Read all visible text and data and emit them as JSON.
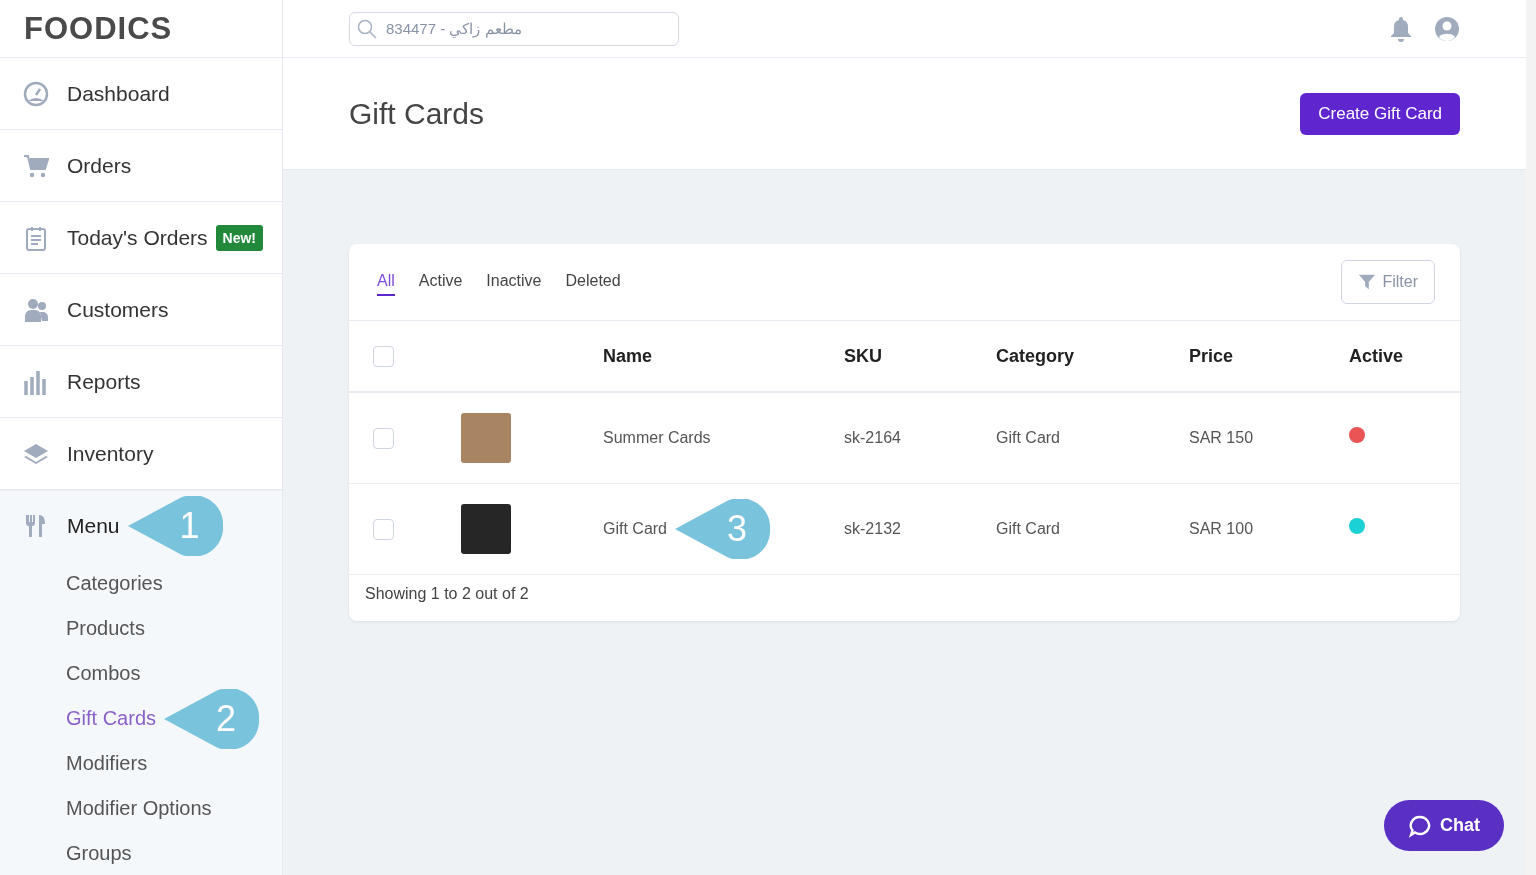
{
  "logo": "FOODICS",
  "search": {
    "value": "834477 - مطعم زاكي"
  },
  "nav": [
    {
      "label": "Dashboard",
      "expanded": false
    },
    {
      "label": "Orders",
      "expanded": false
    },
    {
      "label": "Today's Orders",
      "badge": "New!",
      "expanded": false
    },
    {
      "label": "Customers",
      "expanded": false
    },
    {
      "label": "Reports",
      "expanded": false
    },
    {
      "label": "Inventory",
      "expanded": false
    },
    {
      "label": "Menu",
      "expanded": true,
      "callout": "1",
      "children": [
        {
          "label": "Categories",
          "selected": false
        },
        {
          "label": "Products",
          "selected": false
        },
        {
          "label": "Combos",
          "selected": false
        },
        {
          "label": "Gift Cards",
          "selected": true,
          "callout": "2"
        },
        {
          "label": "Modifiers",
          "selected": false
        },
        {
          "label": "Modifier Options",
          "selected": false
        },
        {
          "label": "Groups",
          "selected": false
        }
      ]
    }
  ],
  "page_title": "Gift Cards",
  "create_button": "Create Gift Card",
  "tabs": [
    {
      "label": "All",
      "selected": true
    },
    {
      "label": "Active",
      "selected": false
    },
    {
      "label": "Inactive",
      "selected": false
    },
    {
      "label": "Deleted",
      "selected": false
    }
  ],
  "filter_button": "Filter",
  "table": {
    "select_all": {
      "checked": false
    },
    "columns": [
      "Name",
      "SKU",
      "Category",
      "Price",
      "Active"
    ],
    "rows": [
      {
        "checked": false,
        "name": "Summer Cards",
        "sku": "sk-2164",
        "category": "Gift Card",
        "price": "SAR 150",
        "color": "#ea5455"
      },
      {
        "checked": false,
        "name": "Gift Card",
        "callout": "3",
        "sku": "sk-2132",
        "category": "Gift Card",
        "price": "SAR 100",
        "color": "#1cd1d6"
      }
    ]
  },
  "footer": "Showing 1 to 2 out of 2",
  "chat_button": "Chat"
}
